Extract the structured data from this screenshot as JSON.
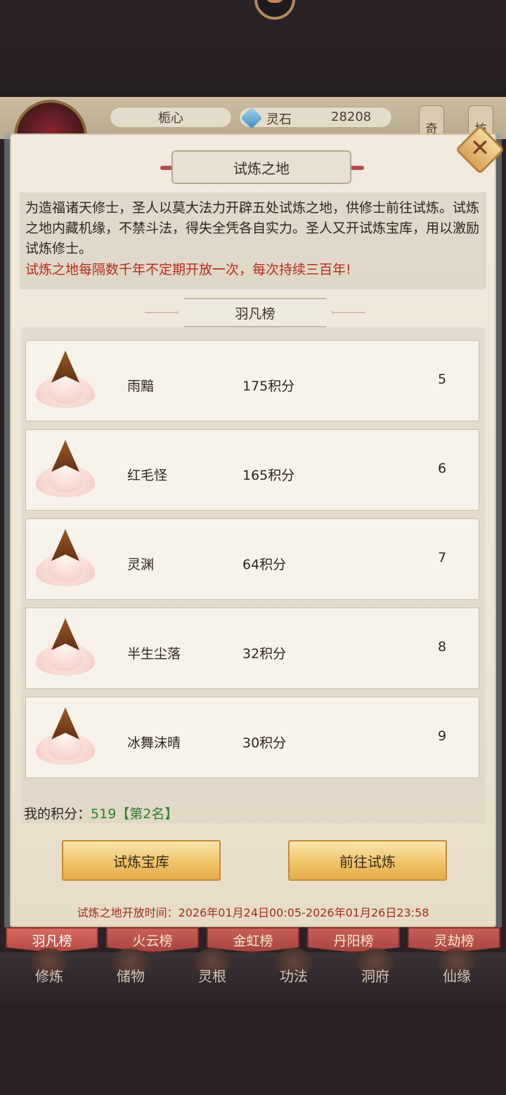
{
  "header": {
    "player_name": "栀心",
    "stone_label": "灵石",
    "stone_value": "28208",
    "side_tabs": [
      "奇",
      "坊"
    ],
    "avatar_icon": "player-avatar",
    "stone_icon": "spirit-stone-icon"
  },
  "panel": {
    "title": "试炼之地",
    "description": "为造福诸天修士，圣人以莫大法力开辟五处试炼之地，供修士前往试炼。试炼之地内藏机缘，不禁斗法，得失全凭各自实力。圣人又开试炼宝库，用以激励试炼修士。",
    "notice": "试炼之地每隔数千年不定期开放一次，每次持续三百年!",
    "board_title": "羽凡榜",
    "entries": [
      {
        "name": "雨黯",
        "score": "175积分",
        "rank": "5"
      },
      {
        "name": "红毛怪",
        "score": "165积分",
        "rank": "6"
      },
      {
        "name": "灵渊",
        "score": "64积分",
        "rank": "7"
      },
      {
        "name": "半生尘落",
        "score": "32积分",
        "rank": "8"
      },
      {
        "name": "冰舞沫晴",
        "score": "30积分",
        "rank": "9"
      }
    ],
    "my_score_label": "我的积分：",
    "my_score_value": "519",
    "my_rank": "【第2名】",
    "buttons": {
      "treasury": "试炼宝库",
      "go": "前往试炼"
    },
    "open_time": "试炼之地开放时间：2026年01月24日00:05-2026年01月26日23:58"
  },
  "board_tabs": [
    "羽凡榜",
    "火云榜",
    "金虹榜",
    "丹阳榜",
    "灵劫榜"
  ],
  "active_tab": "羽凡榜",
  "nav": [
    "修炼",
    "储物",
    "灵根",
    "功法",
    "洞府",
    "仙缘"
  ],
  "colors": {
    "accent_red": "#b72a1e",
    "score_green": "#2f7d33",
    "tab_red": "#a8443f",
    "button_gold": "#f0c46a"
  }
}
